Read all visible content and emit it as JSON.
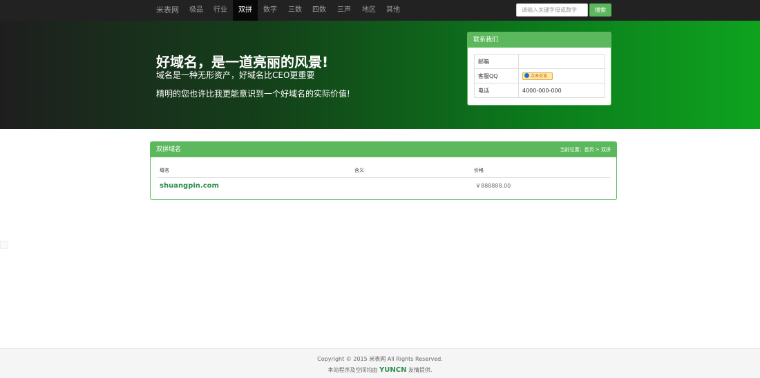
{
  "nav": {
    "brand": "米表网",
    "items": [
      "极品",
      "行业",
      "双拼",
      "数字",
      "三数",
      "四数",
      "三声",
      "地区",
      "其他"
    ],
    "active": "双拼",
    "search_placeholder": "请输入关键字母或数字",
    "search_button": "搜索"
  },
  "hero": {
    "title": "好域名，是一道亮丽的风景!",
    "subtitle1": "域名是一种无形资产，好域名比CEO更重要",
    "subtitle2": "精明的您也许比我更能意识到一个好域名的实际价值!"
  },
  "contact": {
    "title": "联系我们",
    "rows": [
      {
        "label": "邮箱",
        "value": ""
      },
      {
        "label": "客服QQ",
        "value": "点击交谈"
      },
      {
        "label": "电话",
        "value": "4000-000-000"
      }
    ]
  },
  "panel": {
    "title": "双拼域名",
    "breadcrumb": "当前位置：首页 > 双拼",
    "columns": [
      "域名",
      "含义",
      "价格"
    ],
    "rows": [
      {
        "domain": "shuangpin.com",
        "meaning": "",
        "price": "￥888888.00"
      }
    ]
  },
  "footer": {
    "copyright": "Copyright © 2015 米表网 All Rights Reserved.",
    "credit_prefix": "本站程序及空间均由",
    "credit_brand": "YUNCN",
    "credit_suffix": "友情提供."
  },
  "colors": {
    "accent": "#5cb85c",
    "nav_bg": "#222222",
    "link": "#2f8f4f"
  }
}
